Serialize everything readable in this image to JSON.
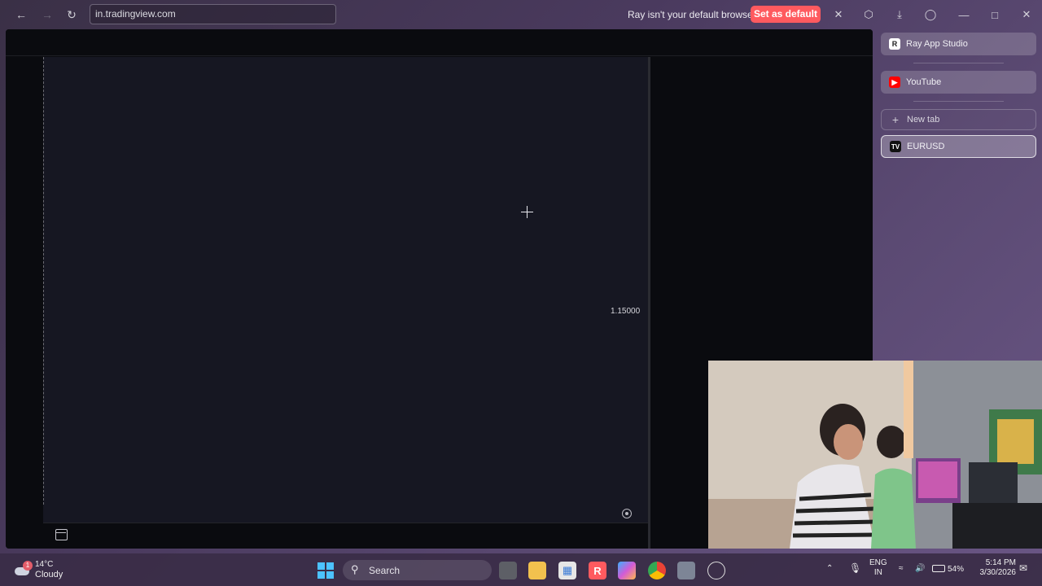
{
  "browser": {
    "url": "in.tradingview.com",
    "notice": "Ray isn't your default browser",
    "set_default_label": "Set as default",
    "icons": [
      "back-icon",
      "forward-icon",
      "reload-icon",
      "close-icon",
      "extensions-icon",
      "downloads-icon",
      "profile-icon",
      "minimize-icon",
      "maximize-icon",
      "window-close-icon"
    ]
  },
  "chart": {
    "price_label": "1.15000",
    "background": "#161722"
  },
  "sidebar": {
    "tabs": [
      {
        "label": "Ray App Studio",
        "icon": "ray-logo-icon"
      },
      {
        "label": "YouTube",
        "icon": "youtube-icon"
      }
    ],
    "new_tab_label": "New tab",
    "active_tab": {
      "label": "EURUSD",
      "icon": "tradingview-icon"
    }
  },
  "taskbar": {
    "weather": {
      "temp": "14°C",
      "condition": "Cloudy",
      "badge": "1"
    },
    "search_label": "Search",
    "tray": {
      "lang": "ENG",
      "region": "IN",
      "battery": "54%",
      "time": "5:14 PM",
      "date": "3/30/2026"
    }
  },
  "colors": {
    "accent": "#ff5a5f",
    "chart_bg": "#161722",
    "app_bg": "#0a0b0f"
  }
}
